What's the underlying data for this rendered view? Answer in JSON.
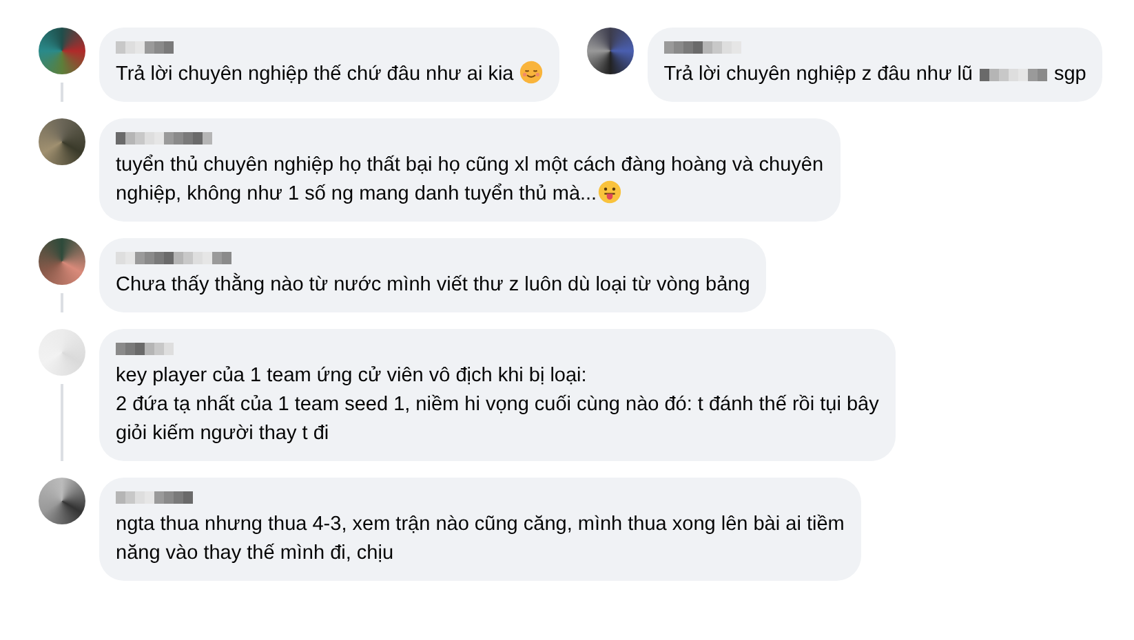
{
  "top_row": [
    {
      "lines": [
        "Trả lời chuyên nghiệp thế chứ đâu như ai kia"
      ],
      "kind": "with-smile",
      "has_replies": true
    },
    {
      "lines": [
        "Trả lời chuyên nghiệp z đâu như lũ"
      ],
      "redacted_then": "sgp",
      "kind": "plain",
      "has_replies": false
    }
  ],
  "comments": [
    {
      "lines": [
        "tuyển thủ chuyên nghiệp họ thất bại họ cũng xl một cách đàng hoàng và chuyên",
        "nghiệp, không như 1 số ng mang danh tuyển thủ mà..."
      ],
      "kind": "with-tongue",
      "has_replies": false
    },
    {
      "lines": [
        "Chưa thấy thằng nào từ nước mình viết thư z luôn dù loại từ vòng bảng"
      ],
      "kind": "plain",
      "has_replies": true
    },
    {
      "lines": [
        "key player của 1 team ứng cử viên vô địch khi bị loại:",
        "2 đứa tạ nhất của 1 team seed 1, niềm hi vọng cuối cùng nào đó: t đánh thế rồi tụi bây",
        "giỏi kiếm người thay t đi"
      ],
      "kind": "plain",
      "has_replies": true
    },
    {
      "lines": [
        "ngta thua nhưng thua 4-3, xem trận nào cũng căng, mình thua xong lên bài ai tiềm",
        "năng vào thay thế mình đi, chịu"
      ],
      "kind": "plain",
      "has_replies": false
    }
  ]
}
